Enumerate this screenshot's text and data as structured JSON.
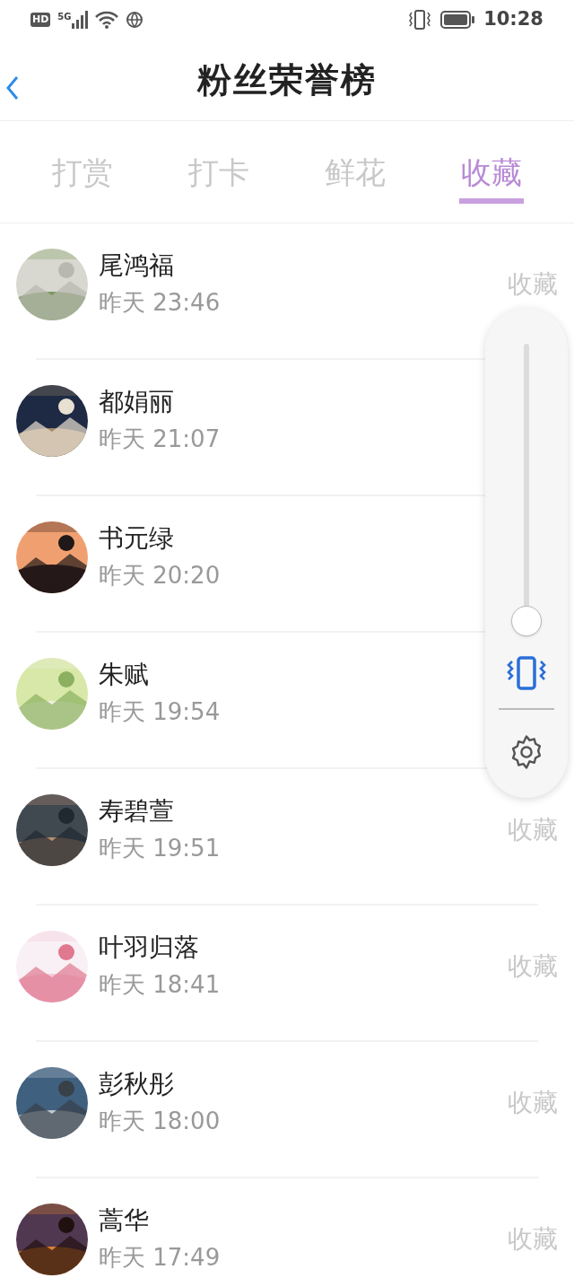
{
  "status_bar": {
    "hd": "HD",
    "network": "5G",
    "time": "10:28"
  },
  "header": {
    "title": "粉丝荣誉榜"
  },
  "tabs": [
    {
      "label": "打赏",
      "selected": false
    },
    {
      "label": "打卡",
      "selected": false
    },
    {
      "label": "鲜花",
      "selected": false
    },
    {
      "label": "收藏",
      "selected": true
    }
  ],
  "rows": [
    {
      "name": "尾鸿福",
      "time": "昨天 23:46",
      "action": "收藏"
    },
    {
      "name": "都娟丽",
      "time": "昨天 21:07"
    },
    {
      "name": "书元绿",
      "time": "昨天 20:20"
    },
    {
      "name": "朱赋",
      "time": "昨天 19:54"
    },
    {
      "name": "寿碧萱",
      "time": "昨天 19:51",
      "action": "收藏"
    },
    {
      "name": "叶羽归落",
      "time": "昨天 18:41",
      "action": "收藏"
    },
    {
      "name": "彭秋彤",
      "time": "昨天 18:00",
      "action": "收藏"
    },
    {
      "name": "蒿华",
      "time": "昨天 17:49",
      "action": "收藏"
    }
  ],
  "volume_panel": {
    "level": 0.04
  }
}
